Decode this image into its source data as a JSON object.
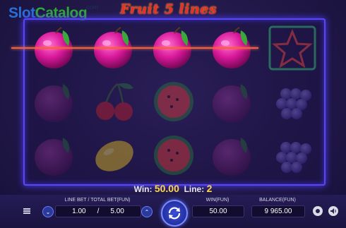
{
  "brand": {
    "part1": "Slot",
    "part2": "Catalog",
    "suffix": ".com"
  },
  "game": {
    "title": "Fruit 5 lines"
  },
  "reels": [
    [
      "plum",
      "plum",
      "plum",
      "plum",
      "star"
    ],
    [
      "plum",
      "cherry",
      "watermelon",
      "plum",
      "grapes"
    ],
    [
      "plum",
      "lemon",
      "watermelon",
      "plum",
      "grapes"
    ]
  ],
  "win_info": {
    "win_label": "Win:",
    "win_value": "50.00",
    "line_label": "Line:",
    "line_value": "2"
  },
  "controls": {
    "line_total_label": "LINE BET / TOTAL BET(FUN)",
    "line_bet": "1.00",
    "separator": "/",
    "total_bet": "5.00",
    "win_label": "WIN(FUN)",
    "win_value": "50.00",
    "balance_label": "BALANCE(FUN)",
    "balance_value": "9 965.00",
    "decrease_symbol": "⌄",
    "increase_symbol": "⌃"
  },
  "colors": {
    "accent": "#5b47f0",
    "win_value": "#ffd84a",
    "payline": "#ff5a3a"
  }
}
